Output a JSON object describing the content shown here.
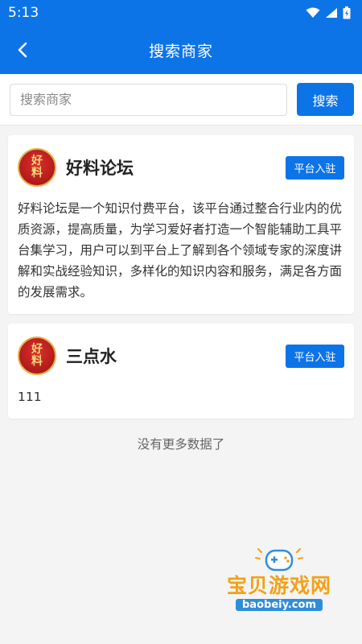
{
  "status_bar": {
    "time": "5:13"
  },
  "header": {
    "title": "搜索商家"
  },
  "search": {
    "placeholder": "搜索商家",
    "value": "",
    "button_label": "搜索"
  },
  "merchants": [
    {
      "logo_text": [
        "好",
        "料"
      ],
      "name": "好料论坛",
      "join_label": "平台入驻",
      "description": "好料论坛是一个知识付费平台，该平台通过整合行业内的优质资源，提高质量，为学习爱好者打造一个智能辅助工具平台集学习，用户可以到平台上了解到各个领域专家的深度讲解和实战经验知识，多样化的知识内容和服务，满足各方面的发展需求。"
    },
    {
      "logo_text": [
        "好",
        "料"
      ],
      "name": "三点水",
      "join_label": "平台入驻",
      "description": "111"
    }
  ],
  "footer": {
    "no_more_text": "没有更多数据了"
  },
  "watermark": {
    "title": "宝贝游戏网",
    "url": "baobeiy.com"
  },
  "colors": {
    "primary": "#0d74e8",
    "background": "#f4f4f4",
    "watermark_orange": "#f1a21a"
  }
}
